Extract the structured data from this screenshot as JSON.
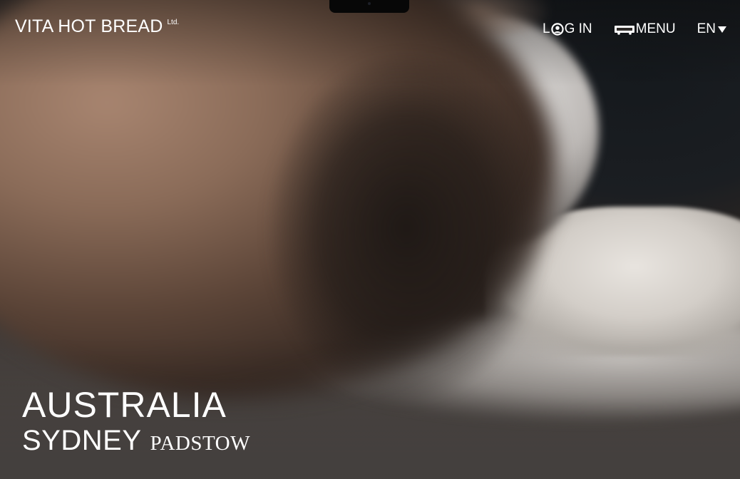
{
  "brand": {
    "name": "VITA HOT BREAD",
    "suffix": "Ltd."
  },
  "nav": {
    "login": {
      "label_before_icon": "L",
      "label_after_icon": "G IN",
      "icon": "user-circle-icon"
    },
    "menu": {
      "label": "MENU",
      "icon": "cart-icon"
    },
    "language": {
      "label": "EN",
      "icon": "caret-down-icon"
    }
  },
  "location": {
    "country": "AUSTRALIA",
    "city": "SYDNEY",
    "suburb": "PADSTOW"
  }
}
